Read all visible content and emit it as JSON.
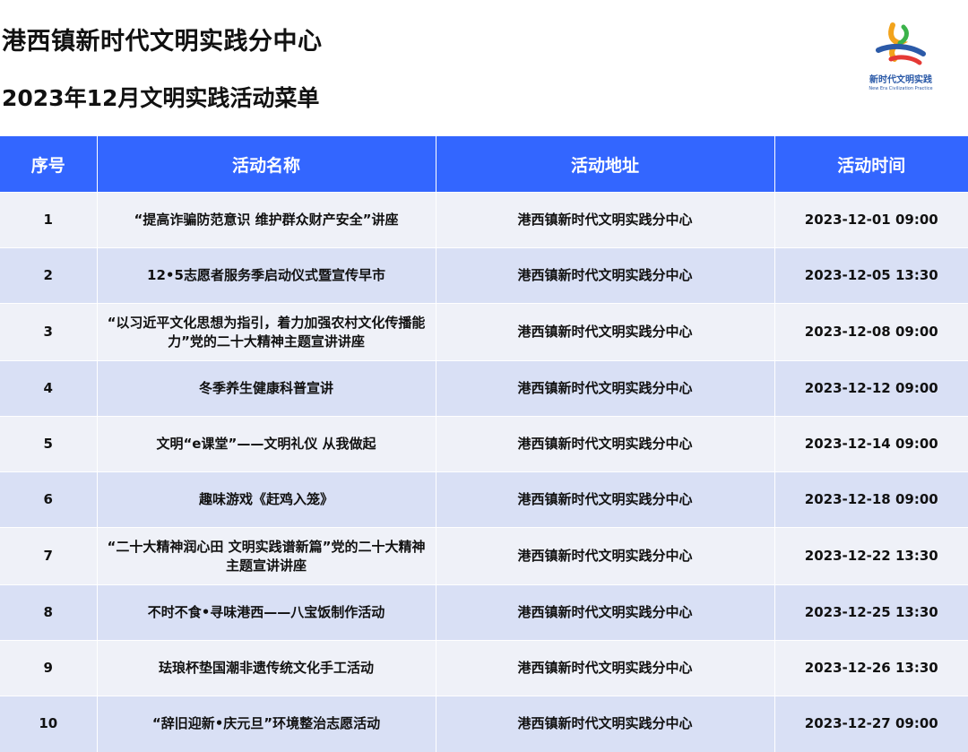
{
  "header": {
    "title": "港西镇新时代文明实践分中心",
    "subtitle": "2023年12月文明实践活动菜单"
  },
  "logo": {
    "name_cn": "新时代文明实践",
    "name_en": "New Era Civilization Practice",
    "icon": "civilization-practice-logo"
  },
  "colors": {
    "header_bg": "#3366ff",
    "row_light": "#eff1f8",
    "row_dark": "#d9e0f5"
  },
  "table": {
    "columns": [
      "序号",
      "活动名称",
      "活动地址",
      "活动时间"
    ],
    "rows": [
      {
        "no": "1",
        "name": "“提高诈骗防范意识 维护群众财产安全”讲座",
        "address": "港西镇新时代文明实践分中心",
        "time": "2023-12-01 09:00"
      },
      {
        "no": "2",
        "name": "12•5志愿者服务季启动仪式暨宣传早市",
        "address": "港西镇新时代文明实践分中心",
        "time": "2023-12-05 13:30"
      },
      {
        "no": "3",
        "name": "“以习近平文化思想为指引，着力加强农村文化传播能力”党的二十大精神主题宣讲讲座",
        "address": "港西镇新时代文明实践分中心",
        "time": "2023-12-08 09:00"
      },
      {
        "no": "4",
        "name": "冬季养生健康科普宣讲",
        "address": "港西镇新时代文明实践分中心",
        "time": "2023-12-12 09:00"
      },
      {
        "no": "5",
        "name": "文明“e课堂”——文明礼仪 从我做起",
        "address": "港西镇新时代文明实践分中心",
        "time": "2023-12-14 09:00"
      },
      {
        "no": "6",
        "name": "趣味游戏《赶鸡入笼》",
        "address": "港西镇新时代文明实践分中心",
        "time": "2023-12-18 09:00"
      },
      {
        "no": "7",
        "name": "“二十大精神润心田 文明实践谱新篇”党的二十大精神主题宣讲讲座",
        "address": "港西镇新时代文明实践分中心",
        "time": "2023-12-22 13:30"
      },
      {
        "no": "8",
        "name": "不时不食•寻味港西——八宝饭制作活动",
        "address": "港西镇新时代文明实践分中心",
        "time": "2023-12-25 13:30"
      },
      {
        "no": "9",
        "name": "珐琅杯垫国潮非遗传统文化手工活动",
        "address": "港西镇新时代文明实践分中心",
        "time": "2023-12-26 13:30"
      },
      {
        "no": "10",
        "name": "“辞旧迎新•庆元旦”环境整治志愿活动",
        "address": "港西镇新时代文明实践分中心",
        "time": "2023-12-27 09:00"
      }
    ]
  }
}
